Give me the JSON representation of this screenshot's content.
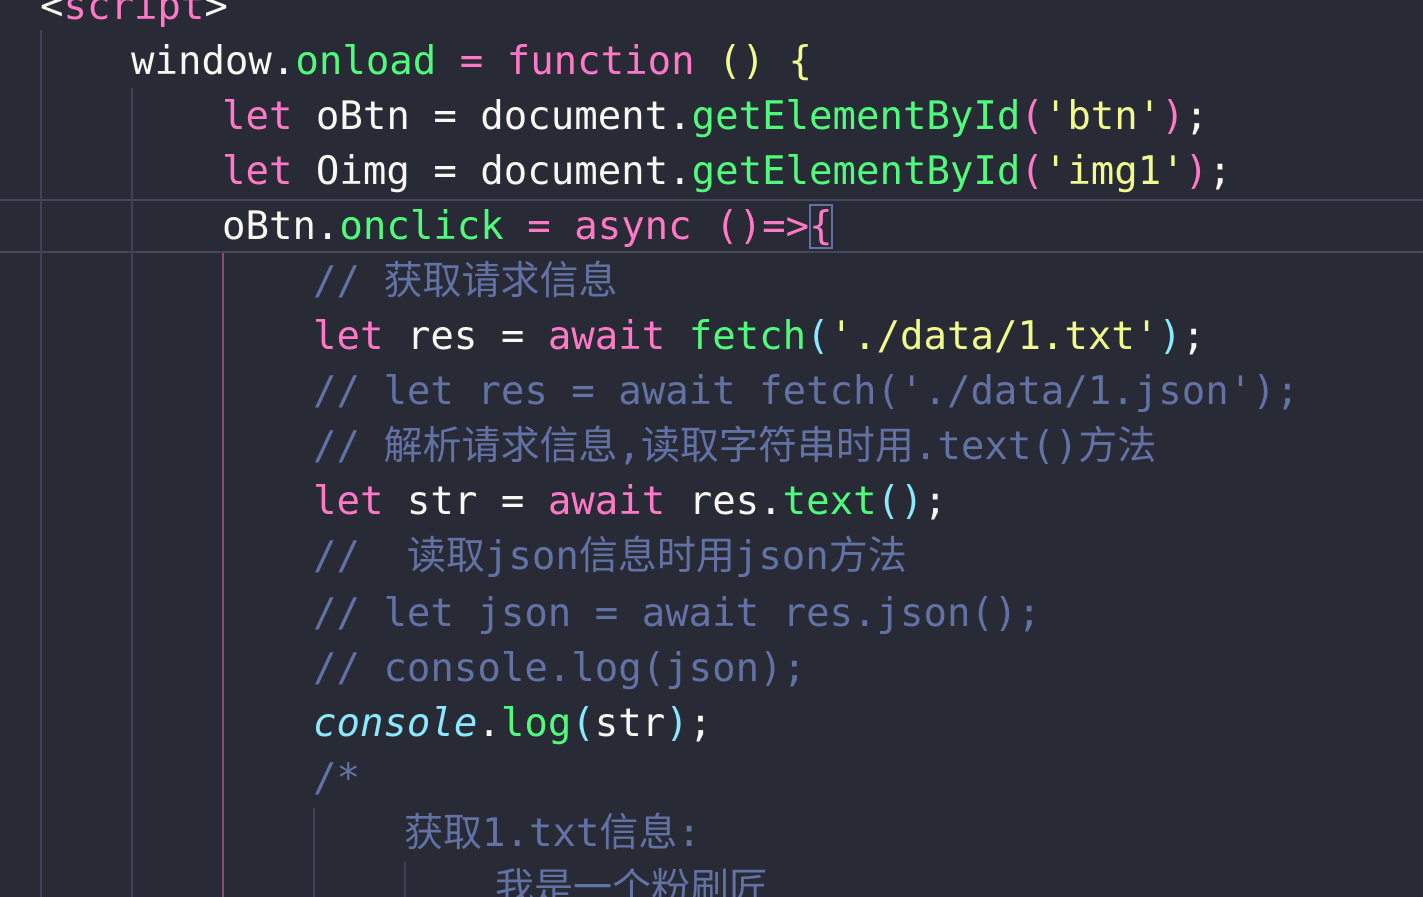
{
  "editor": {
    "theme": "dracula",
    "colors": {
      "background": "#282a36",
      "foreground": "#f8f8f2",
      "keyword": "#ff79c6",
      "function": "#50fa7b",
      "string": "#f1fa8c",
      "comment": "#6272a4",
      "builtin": "#8be9fd"
    },
    "lines": {
      "l0": {
        "open": "<",
        "tag": "script",
        "close": ">"
      },
      "l1": {
        "obj": "window.",
        "prop": "onload",
        "eq": " = ",
        "kw": "function",
        "sp": " ",
        "paren": "()",
        "sp2": " ",
        "brace": "{"
      },
      "l2": {
        "kw": "let",
        "rest": " oBtn = document.",
        "fn": "getElementById",
        "po": "(",
        "str": "'btn'",
        "pc": ")",
        "end": ";"
      },
      "l3": {
        "kw": "let",
        "rest": " Oimg = document.",
        "fn": "getElementById",
        "po": "(",
        "str": "'img1'",
        "pc": ")",
        "end": ";"
      },
      "l4": {
        "obj": "oBtn.",
        "prop": "onclick",
        "eq": " = ",
        "kw": "async",
        "sp": " ",
        "paren": "()",
        "arrow": "=>",
        "brace": "{"
      },
      "l5": {
        "comment": "// 获取请求信息"
      },
      "l6": {
        "kw": "let",
        "rest": " res = ",
        "kw2": "await",
        "sp": " ",
        "fn": "fetch",
        "po": "(",
        "str": "'./data/1.txt'",
        "pc": ")",
        "end": ";"
      },
      "l7": {
        "comment": "// let res = await fetch('./data/1.json');"
      },
      "l8": {
        "comment": "// 解析请求信息,读取字符串时用.text()方法"
      },
      "l9": {
        "kw": "let",
        "rest": " str = ",
        "kw2": "await",
        "obj": " res.",
        "fn": "text",
        "paren": "()",
        "end": ";"
      },
      "l10": {
        "comment": "//  读取json信息时用json方法"
      },
      "l11": {
        "comment": "// let json = await res.json();"
      },
      "l12": {
        "comment": "// console.log(json);"
      },
      "l13": {
        "builtin": "console",
        "dot": ".",
        "fn": "log",
        "po": "(",
        "arg": "str",
        "pc": ")",
        "end": ";"
      },
      "l14": {
        "comment": "/*"
      },
      "l15": {
        "comment": "获取1.txt信息:"
      },
      "l16": {
        "comment": "我是一个粉刷匠"
      }
    }
  }
}
